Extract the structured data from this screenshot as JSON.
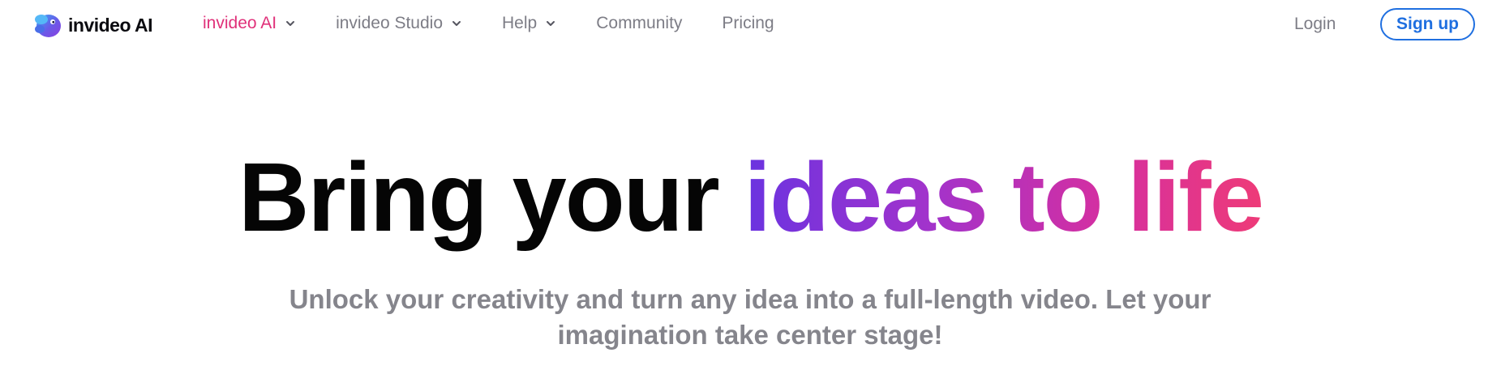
{
  "brand": {
    "name": "invideo AI",
    "icon": "invideo-logo-icon"
  },
  "nav": {
    "items": [
      {
        "label": "invideo AI",
        "has_dropdown": true,
        "active": true
      },
      {
        "label": "invideo Studio",
        "has_dropdown": true,
        "active": false
      },
      {
        "label": "Help",
        "has_dropdown": true,
        "active": false
      },
      {
        "label": "Community",
        "has_dropdown": false,
        "active": false
      },
      {
        "label": "Pricing",
        "has_dropdown": false,
        "active": false
      }
    ],
    "login_label": "Login",
    "signup_label": "Sign up"
  },
  "hero": {
    "title_plain": "Bring your",
    "title_highlight": "ideas to life",
    "subtitle_line1": "Unlock your creativity and turn any idea into a full-length video. Let your",
    "subtitle_line2": "imagination take center stage!"
  },
  "colors": {
    "active_nav": "#e0317a",
    "nav_text": "#7d7d86",
    "signup_accent": "#1f6fe0",
    "gradient_start": "#6a33e0",
    "gradient_end": "#ee3b78",
    "subtitle": "#85858c"
  }
}
